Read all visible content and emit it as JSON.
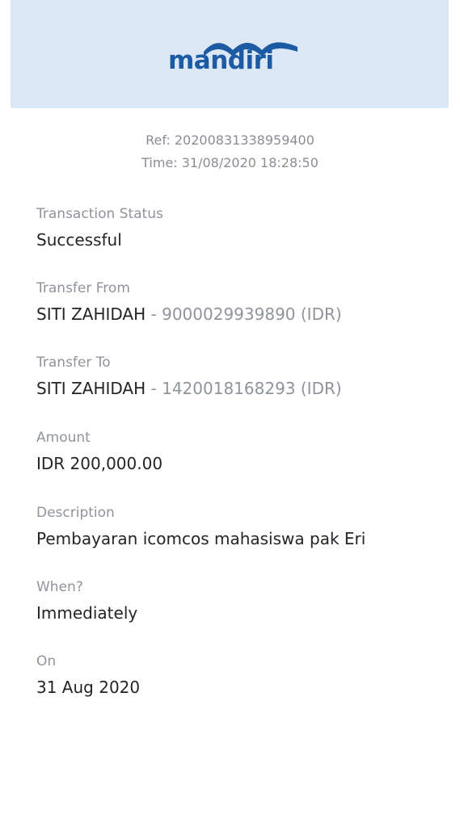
{
  "header": {
    "brand_name": "mandiri",
    "brand_color": "#1d5aa4",
    "background_color": "#dbe7f4"
  },
  "reference": {
    "ref_line": "Ref: 20200831338959400",
    "time_line": "Time: 31/08/2020 18:28:50"
  },
  "fields": {
    "status": {
      "label": "Transaction Status",
      "value": "Successful"
    },
    "from": {
      "label": "Transfer From",
      "name": "SITI ZAHIDAH",
      "separator": " - ",
      "account": "9000029939890 (IDR)"
    },
    "to": {
      "label": "Transfer To",
      "name": "SITI ZAHIDAH",
      "separator": " - ",
      "account": "1420018168293 (IDR)"
    },
    "amount": {
      "label": "Amount",
      "value": "IDR 200,000.00"
    },
    "description": {
      "label": "Description",
      "value": "Pembayaran icomcos mahasiswa pak Eri"
    },
    "when": {
      "label": "When?",
      "value": "Immediately"
    },
    "on": {
      "label": "On",
      "value": "31 Aug 2020"
    }
  }
}
